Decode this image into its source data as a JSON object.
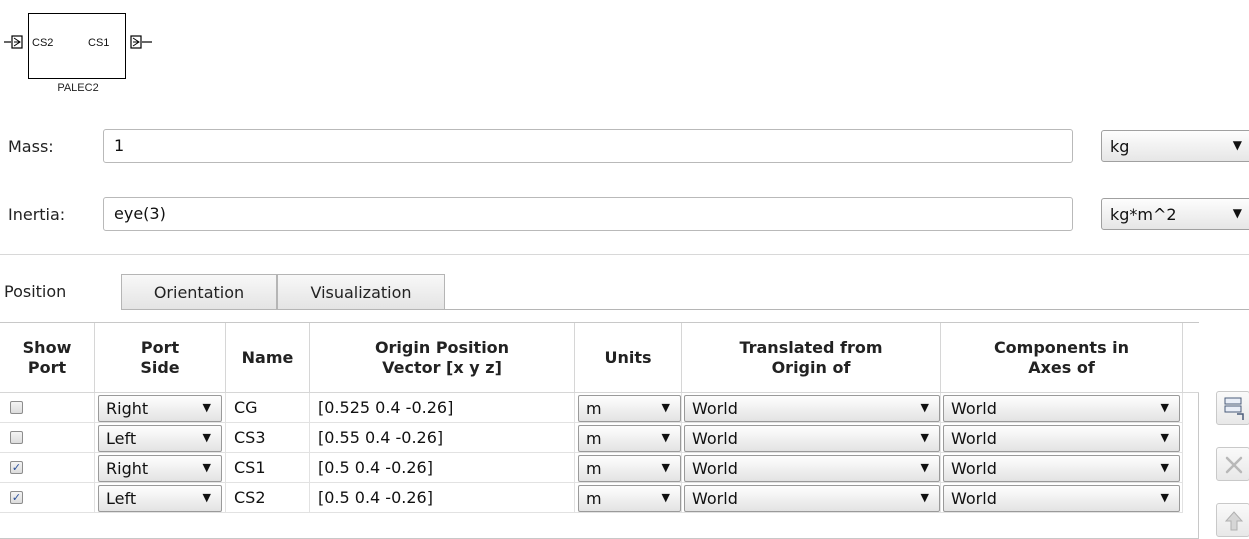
{
  "block": {
    "name": "PALEC2",
    "left_port_label": "CS2",
    "right_port_label": "CS1"
  },
  "mass": {
    "label": "Mass:",
    "value": "1",
    "unit": "kg"
  },
  "inertia": {
    "label": "Inertia:",
    "value": "eye(3)",
    "unit": "kg*m^2"
  },
  "tabs": [
    {
      "label": "Position",
      "active": true
    },
    {
      "label": "Orientation",
      "active": false
    },
    {
      "label": "Visualization",
      "active": false
    }
  ],
  "table": {
    "columns": [
      "Show\nPort",
      "Port\nSide",
      "Name",
      "Origin Position\nVector [x y z]",
      "Units",
      "Translated from\nOrigin of",
      "Components in\nAxes of"
    ],
    "rows": [
      {
        "show_port": false,
        "port_side": "Right",
        "name": "CG",
        "origin": "[0.525 0.4 -0.26]",
        "units": "m",
        "translated_from": "World",
        "components_in": "World"
      },
      {
        "show_port": false,
        "port_side": "Left",
        "name": "CS3",
        "origin": "[0.55 0.4 -0.26]",
        "units": "m",
        "translated_from": "World",
        "components_in": "World"
      },
      {
        "show_port": true,
        "port_side": "Right",
        "name": "CS1",
        "origin": "[0.5 0.4 -0.26]",
        "units": "m",
        "translated_from": "World",
        "components_in": "World"
      },
      {
        "show_port": true,
        "port_side": "Left",
        "name": "CS2",
        "origin": "[0.5 0.4 -0.26]",
        "units": "m",
        "translated_from": "World",
        "components_in": "World"
      }
    ]
  },
  "side_buttons": [
    {
      "icon": "add-row-icon"
    },
    {
      "icon": "delete-row-icon"
    },
    {
      "icon": "move-up-icon"
    }
  ],
  "colors": {
    "checkbox_check": "#2a4f9a",
    "selection_border": "#9a9a9a"
  }
}
